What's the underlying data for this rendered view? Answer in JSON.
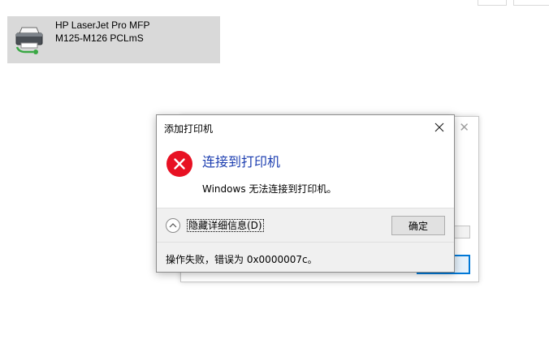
{
  "printer": {
    "name_line1": "HP LaserJet Pro MFP",
    "name_line2": "M125-M126 PCLmS",
    "icon": "printer-icon"
  },
  "dialog": {
    "title": "添加打印机",
    "close_icon": "close-icon",
    "error_icon": "error-icon",
    "main_instruction": "连接到打印机",
    "content": "Windows 无法连接到打印机。",
    "expand_label": "隐藏详细信息(D)",
    "ok_label": "确定",
    "footer_text": "操作失败，错误为 0x0000007c。"
  },
  "background_dialog": {
    "close_glyph": "✕"
  },
  "colors": {
    "error_red": "#e81123",
    "instruction_blue": "#1c3eb0",
    "tile_selected": "#d9d9d9",
    "focus_blue": "#0078d7"
  }
}
